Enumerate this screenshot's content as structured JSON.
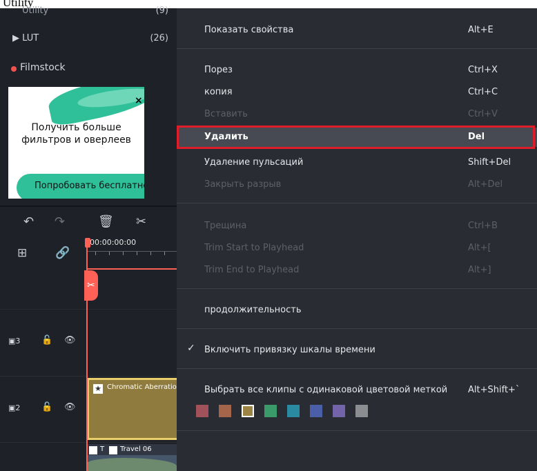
{
  "top_text": "Utility",
  "library": {
    "utility": {
      "label": "Utility",
      "count": "(9)"
    },
    "lut": {
      "label": "▶  LUT",
      "count": "(26)"
    },
    "filmstock": "Filmstock",
    "promo_text": "Получить больше фильтров и оверлеев",
    "promo_button": "Попробовать бесплатно"
  },
  "timeline": {
    "timecode": "00:00:00:00",
    "tracks": [
      {
        "num": "3",
        "label": "▣3"
      },
      {
        "num": "2",
        "label": "▣2"
      }
    ],
    "clip_chromatic": "Chromatic Aberration",
    "clip_travel": "Travel 06",
    "clip_title_letter": "T"
  },
  "menu": {
    "items": [
      {
        "label": "Показать свойства",
        "shortcut": "Alt+E",
        "disabled": false
      },
      {
        "label": "Порез",
        "shortcut": "Ctrl+X",
        "disabled": false
      },
      {
        "label": "копия",
        "shortcut": "Ctrl+C",
        "disabled": false
      },
      {
        "label": "Вставить",
        "shortcut": "Ctrl+V",
        "disabled": true
      },
      {
        "label": "Удалить",
        "shortcut": "Del",
        "disabled": false,
        "selected": true
      },
      {
        "label": "Удаление пульсаций",
        "shortcut": "Shift+Del",
        "disabled": false
      },
      {
        "label": "Закрыть разрыв",
        "shortcut": "Alt+Del",
        "disabled": true
      },
      {
        "label": "Трещина",
        "shortcut": "Ctrl+B",
        "disabled": true
      },
      {
        "label": "Trim Start to Playhead",
        "shortcut": "Alt+[",
        "disabled": true
      },
      {
        "label": "Trim End to Playhead",
        "shortcut": "Alt+]",
        "disabled": true
      },
      {
        "label": "продолжительность",
        "shortcut": "",
        "disabled": false
      },
      {
        "label": "Включить привязку шкалы времени",
        "shortcut": "",
        "disabled": false,
        "checked": true
      },
      {
        "label": "Выбрать все клипы с одинаковой цветовой меткой",
        "shortcut": "Alt+Shift+`",
        "disabled": false
      }
    ],
    "color_swatches": [
      "#a0515a",
      "#a5654a",
      "#9c8544",
      "#3a9a6a",
      "#2a8aa2",
      "#4a5fa8",
      "#7363a8",
      "#8b8d90"
    ],
    "selected_swatch": 2
  },
  "colors": {
    "accent_red": "#ff6157",
    "highlight_border": "#e01e2a",
    "menu_bg": "#2a2c33"
  }
}
